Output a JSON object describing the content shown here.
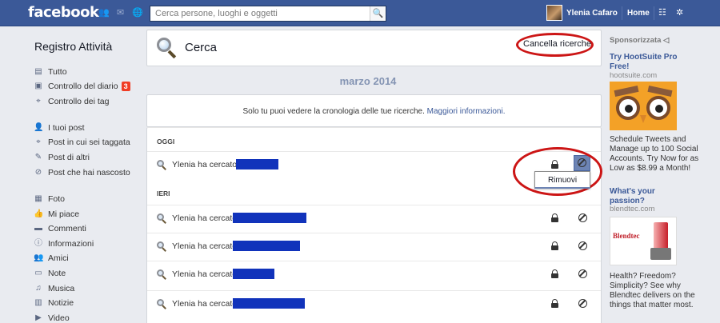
{
  "topbar": {
    "logo": "facebook",
    "search_placeholder": "Cerca persone, luoghi e oggetti",
    "user_name": "Ylenia Cafaro",
    "home_label": "Home"
  },
  "sidebar": {
    "title": "Registro Attività",
    "items": [
      {
        "label": "Tutto",
        "icon": "page-icon"
      },
      {
        "label": "Controllo del diario",
        "icon": "timeline-review-icon",
        "badge": "3"
      },
      {
        "label": "Controllo dei tag",
        "icon": "tag-icon"
      },
      {
        "label": "I tuoi post",
        "icon": "person-icon"
      },
      {
        "label": "Post in cui sei taggata",
        "icon": "tag-icon"
      },
      {
        "label": "Post di altri",
        "icon": "post-icon"
      },
      {
        "label": "Post che hai nascosto",
        "icon": "hidden-icon"
      },
      {
        "label": "Foto",
        "icon": "photo-icon"
      },
      {
        "label": "Mi piace",
        "icon": "like-icon"
      },
      {
        "label": "Commenti",
        "icon": "comment-icon"
      },
      {
        "label": "Informazioni",
        "icon": "info-icon"
      },
      {
        "label": "Amici",
        "icon": "friends-icon"
      },
      {
        "label": "Note",
        "icon": "note-icon"
      },
      {
        "label": "Musica",
        "icon": "music-icon"
      },
      {
        "label": "Notizie",
        "icon": "news-icon"
      },
      {
        "label": "Video",
        "icon": "video-icon"
      }
    ]
  },
  "main": {
    "title": "Cerca",
    "clear_button": "Cancella ricerche",
    "month": "marzo 2014",
    "notice": "Solo tu puoi vedere la cronologia delle tue ricerche.",
    "notice_link": "Maggiori informazioni.",
    "sections": [
      {
        "label": "OGGI",
        "rows": [
          {
            "text": "Ylenia ha cercato"
          }
        ]
      },
      {
        "label": "IERI",
        "rows": [
          {
            "text": "Ylenia ha cercato"
          },
          {
            "text": "Ylenia ha cercato"
          },
          {
            "text": "Ylenia ha cercato"
          },
          {
            "text": "Ylenia ha cercato"
          }
        ]
      }
    ],
    "remove_menu_label": "Rimuovi"
  },
  "ads": {
    "header": "Sponsorizzata",
    "items": [
      {
        "title": "Try HootSuite Pro Free!",
        "domain": "hootsuite.com",
        "body": "Schedule Tweets and Manage up to 100 Social Accounts. Try Now for as Low as $8.99 a Month!"
      },
      {
        "title": "What's your passion?",
        "domain": "blendtec.com",
        "image_text": "Blendtec",
        "body": "Health? Freedom? Simplicity? See why Blendtec delivers on the things that matter most."
      }
    ]
  },
  "colors": {
    "header_blue": "#3b5998",
    "highlight_red": "#cc1515",
    "redaction_blue": "#1133bb",
    "badge_red": "#f03d25"
  }
}
